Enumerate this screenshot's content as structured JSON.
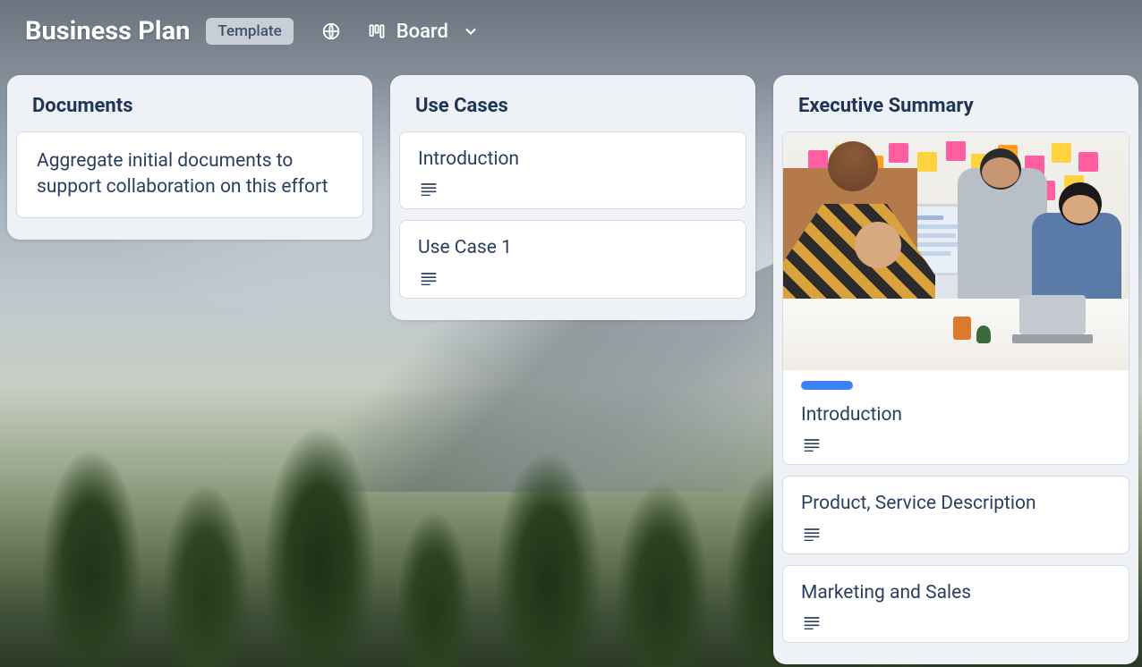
{
  "header": {
    "title": "Business Plan",
    "badge": "Template",
    "view_label": "Board"
  },
  "columns": [
    {
      "title": "Documents",
      "cards": [
        {
          "title": "Aggregate initial documents to support collaboration on this effort",
          "has_description": false,
          "has_image": false,
          "has_pill": false
        }
      ]
    },
    {
      "title": "Use Cases",
      "cards": [
        {
          "title": "Introduction",
          "has_description": true,
          "has_image": false,
          "has_pill": false
        },
        {
          "title": "Use Case 1",
          "has_description": true,
          "has_image": false,
          "has_pill": false
        }
      ]
    },
    {
      "title": "Executive Summary",
      "cards": [
        {
          "title": "Introduction",
          "has_description": true,
          "has_image": true,
          "has_pill": true
        },
        {
          "title": "Product, Service Description",
          "has_description": true,
          "has_image": false,
          "has_pill": false
        },
        {
          "title": "Marketing and Sales",
          "has_description": true,
          "has_image": false,
          "has_pill": false
        }
      ]
    }
  ]
}
